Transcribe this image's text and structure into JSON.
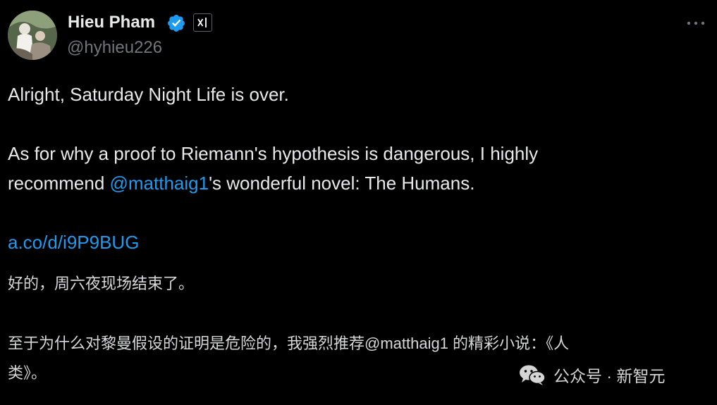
{
  "author": {
    "name": "Hieu Pham",
    "handle": "@hyhieu226",
    "verified": true,
    "avatar_icon": "profile-photo"
  },
  "tweet": {
    "line1": "Alright, Saturday Night Life is over.",
    "line2": "As for why a proof to Riemann's hypothesis is dangerous, I highly",
    "line3_before": "recommend ",
    "mention": "@matthaig1",
    "line3_after": "'s wonderful novel: The Humans.",
    "link": "a.co/d/i9P9BUG"
  },
  "translation": {
    "line1": "好的，周六夜现场结束了。",
    "line2": "至于为什么对黎曼假设的证明是危险的，我强烈推荐@matthaig1 的精彩小说：《人",
    "line3": "类》。"
  },
  "watermark": {
    "text": "公众号 · 新智元",
    "icon": "wechat-icon"
  },
  "colors": {
    "background": "#000000",
    "text": "#e7e9ea",
    "secondary": "#71767b",
    "link": "#1d9bf0",
    "verified": "#1d9bf0"
  }
}
